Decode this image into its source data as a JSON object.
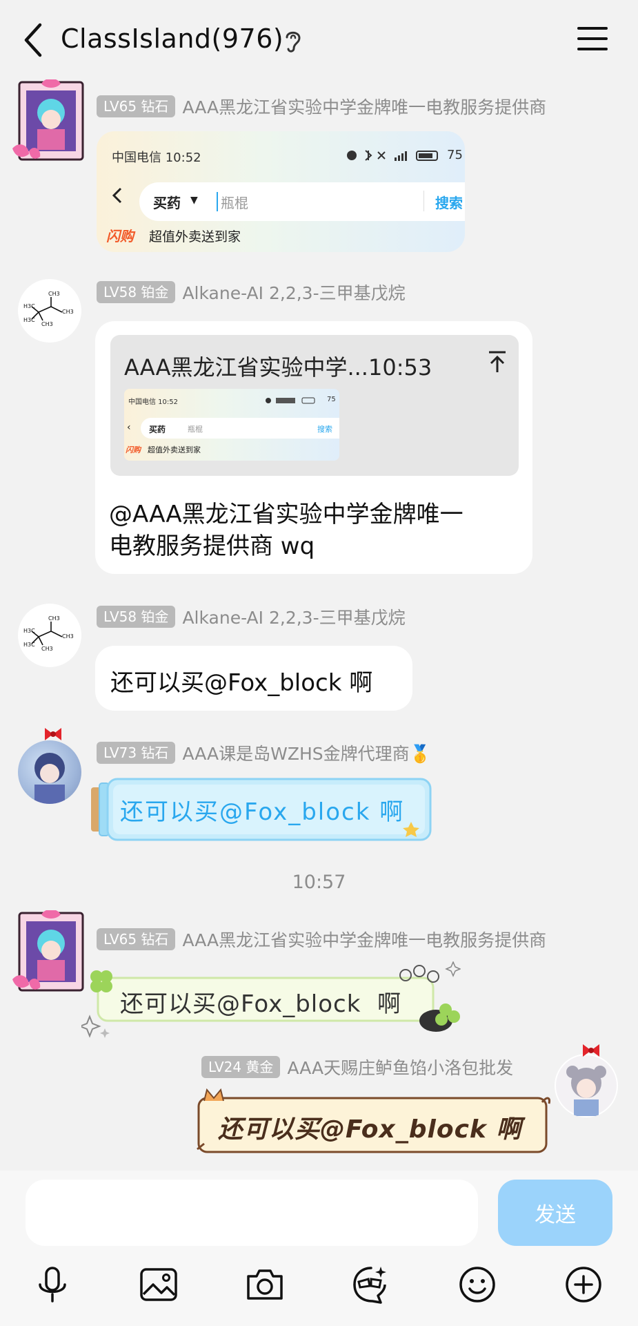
{
  "header": {
    "title": "ClassIsland(976)",
    "back_icon": "chevron-left-icon",
    "ear_icon": "ear-icon",
    "menu_icon": "hamburger-menu-icon"
  },
  "messages": [
    {
      "badge": "LV65 钻石",
      "sender": "AAA黑龙江省实验中学金牌唯一电教服务提供商",
      "image": {
        "status": "中国电信 10:52",
        "battery": "75",
        "search_category": "买药",
        "search_query": "瓶棍",
        "search_button": "搜索",
        "promo_brand": "闪购",
        "promo_text": "超值外卖送到家"
      }
    },
    {
      "badge": "LV58 铂金",
      "sender": "Alkane-AI 2,2,3-三甲基戊烷",
      "quote": {
        "header": "AAA黑龙江省实验中学...10:53",
        "status": "中国电信 10:52",
        "battery": "75",
        "search_category": "买药",
        "search_query": "瓶棍",
        "search_button": "搜索",
        "promo_brand": "闪购",
        "promo_text": "超值外卖送到家"
      },
      "text_line1": "@AAA黑龙江省实验中学金牌唯一",
      "text_line2": "电教服务提供商 wq"
    },
    {
      "badge": "LV58 铂金",
      "sender": "Alkane-AI 2,2,3-三甲基戊烷",
      "text": "还可以买@Fox_block 啊"
    },
    {
      "badge": "LV73 钻石",
      "sender": "AAA课是岛WZHS金牌代理商🥇",
      "text": "还可以买@Fox_block 啊"
    },
    {
      "badge": "LV65 钻石",
      "sender": "AAA黑龙江省实验中学金牌唯一电教服务提供商",
      "text": "还可以买@Fox_block  啊"
    },
    {
      "badge": "LV24 黄金",
      "sender": "AAA天赐庄鲈鱼馅小洛包批发",
      "text": "还可以买@Fox_block 啊"
    }
  ],
  "timestamp": "10:57",
  "molecule_labels": {
    "ch3": "CH3",
    "h3c": "H3C"
  },
  "input": {
    "placeholder": "",
    "send_label": "发送",
    "tools": [
      "microphone-icon",
      "image-icon",
      "camera-icon",
      "ai-face-icon",
      "emoji-icon",
      "plus-icon"
    ]
  },
  "colors": {
    "send_button": "#9bd3fb",
    "badge": "#b9b9b9",
    "sender": "#8c8c8c",
    "accent_blue": "#29a7ee"
  }
}
